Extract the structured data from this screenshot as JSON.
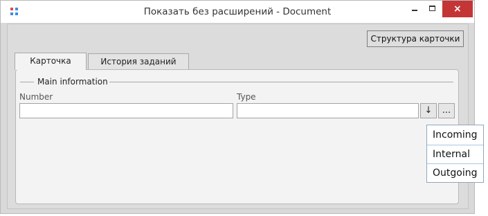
{
  "window": {
    "title": "Показать без расширений - Document",
    "controls": {
      "minimize": "minimize",
      "maximize": "maximize",
      "close": "×"
    },
    "icon_colors": [
      "#e04b4b",
      "#3a8ee6",
      "#3a8ee6",
      "#3a8ee6"
    ]
  },
  "toolbar": {
    "structure_button": "Структура карточки"
  },
  "tabs": [
    {
      "label": "Карточка",
      "active": true
    },
    {
      "label": "История заданий",
      "active": false
    }
  ],
  "main_info": {
    "title": "Main information",
    "number": {
      "label": "Number",
      "value": ""
    },
    "type": {
      "label": "Type",
      "value": "",
      "dropdown_button": "↓",
      "browse_button": "..."
    }
  },
  "type_dropdown": {
    "options": [
      "Incoming",
      "Internal",
      "Outgoing"
    ]
  },
  "colors": {
    "accent_close": "#c43535",
    "dropdown_border": "#8fa6bf"
  }
}
